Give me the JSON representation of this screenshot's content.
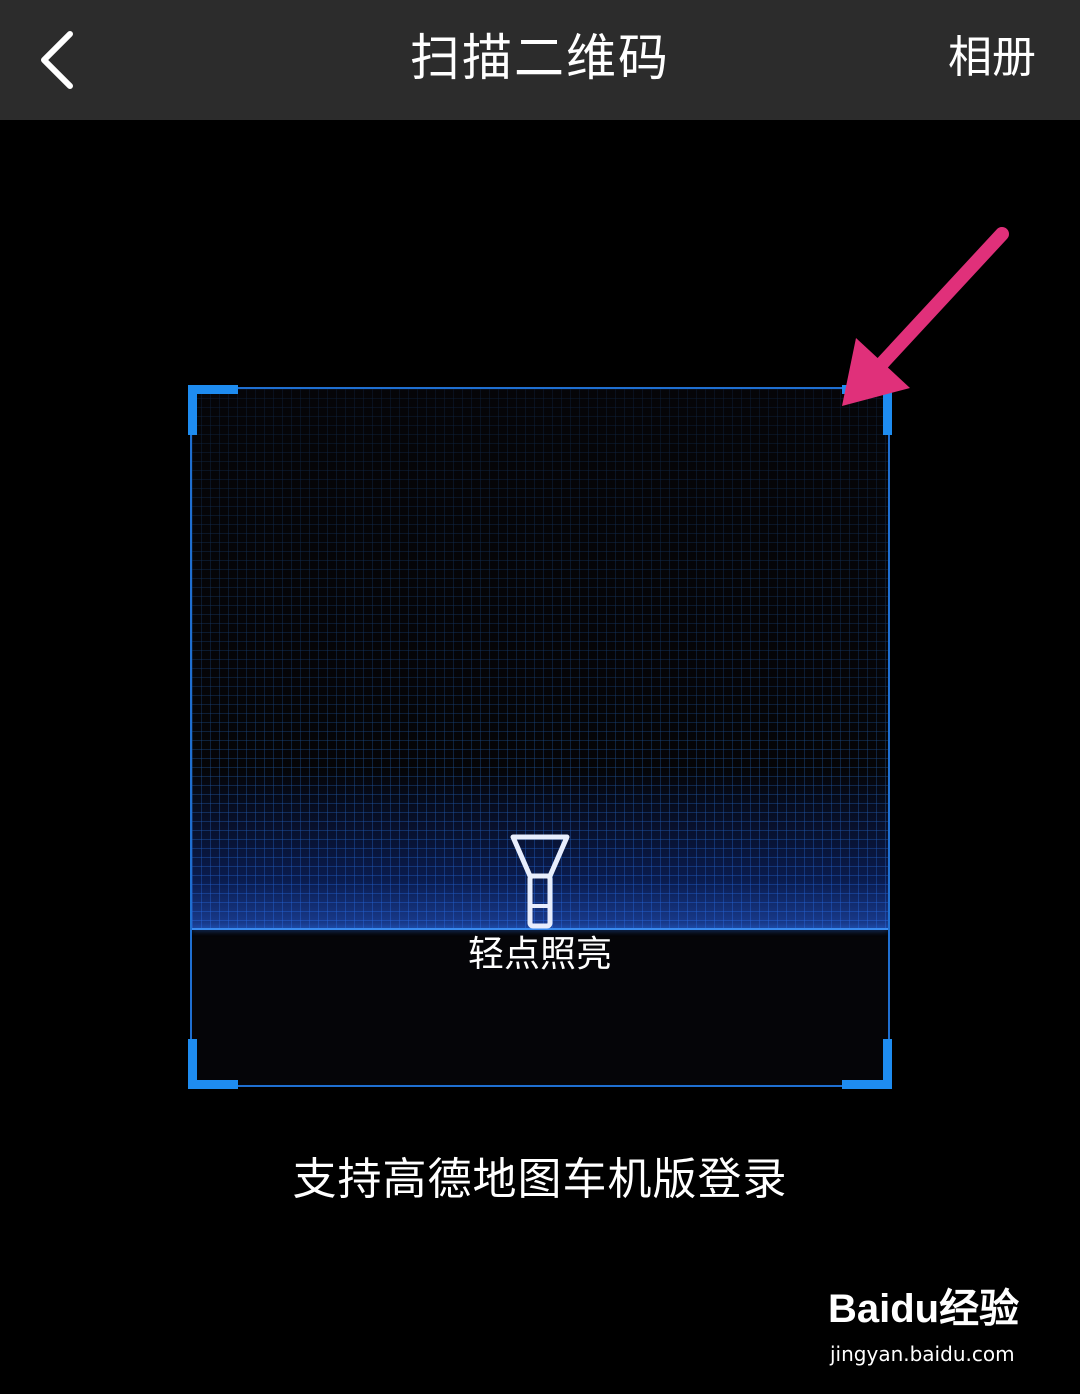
{
  "nav": {
    "title": "扫描二维码",
    "album_label": "相册"
  },
  "scanner": {
    "flashlight_label": "轻点照亮",
    "frame_color": "#1e8cf0"
  },
  "hint": {
    "text": "支持高德地图车机版登录"
  },
  "annotation": {
    "arrow_color": "#e0307a"
  },
  "watermark": {
    "logo_text": "Baidu经验",
    "url": "jingyan.baidu.com"
  },
  "icons": {
    "back": "chevron-left-icon",
    "flashlight": "flashlight-icon",
    "arrow": "arrow-icon"
  }
}
